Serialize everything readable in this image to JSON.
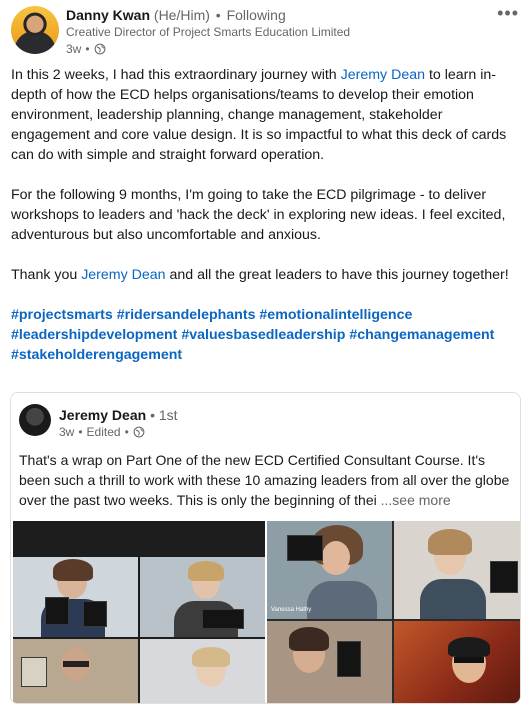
{
  "post": {
    "author": {
      "name": "Danny Kwan",
      "pronouns": "(He/Him)",
      "separator": "•",
      "follow_status": "Following",
      "headline": "Creative Director of Project Smarts Education Limited",
      "time": "3w",
      "time_separator": "•"
    },
    "more_label": "•••",
    "body": {
      "p1_before": "In this 2 weeks, I had this extraordinary journey with ",
      "p1_mention": "Jeremy Dean",
      "p1_after": " to learn in-depth of how the ECD helps organisations/teams to develop their emotion environment, leadership planning, change management, stakeholder engagement and core value design. It is so impactful to what this deck of cards can do with simple and straight forward operation.",
      "p2": "For the following 9 months, I'm going to take the ECD pilgrimage - to deliver workshops to leaders and 'hack the deck' in exploring new ideas. I feel excited, adventurous but also uncomfortable and anxious.",
      "p3_before": "Thank you ",
      "p3_mention": "Jeremy Dean",
      "p3_after": " and all the great leaders to have this journey together!",
      "hashtags": [
        "#projectsmarts",
        "#ridersandelephants",
        "#emotionalintelligence",
        "#leadershipdevelopment",
        "#valuesbasedleadership",
        "#changemanagement",
        "#stakeholderengagement"
      ]
    }
  },
  "shared": {
    "author": {
      "name": "Jeremy Dean",
      "separator": "•",
      "degree": "1st",
      "time": "3w",
      "edited": "Edited",
      "time_separator": "•"
    },
    "text": "That's a wrap on Part One of the new ECD Certified Consultant Course. It's been such a thrill to work with these 10 amazing leaders from all over the globe over the past two weeks. This is only the beginning of thei",
    "see_more": "...see more",
    "photo_name_tag": "Vanessa Hathy"
  },
  "colors": {
    "link": "#0a66c2",
    "text": "#191919",
    "muted": "#666666"
  }
}
